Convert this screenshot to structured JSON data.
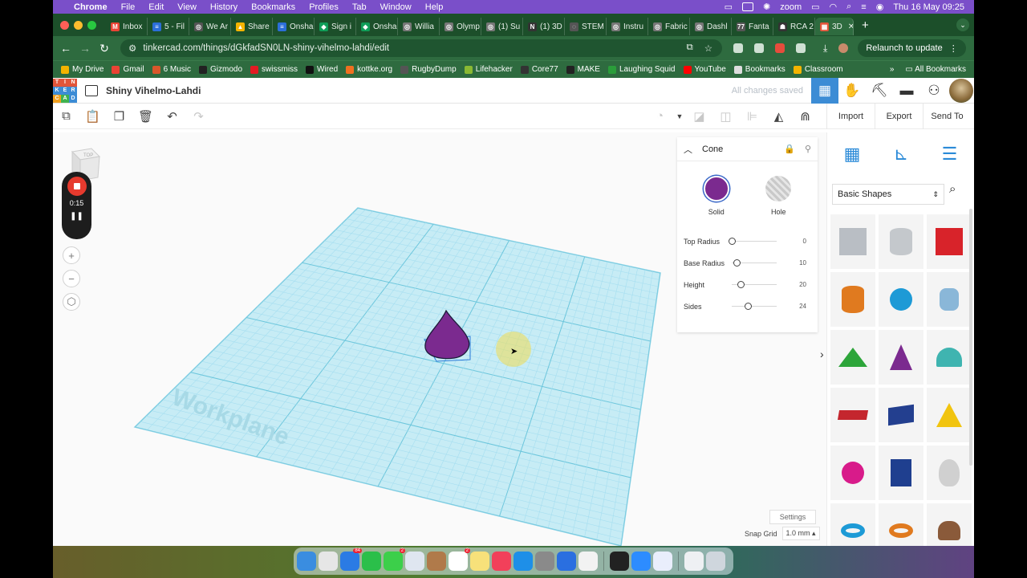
{
  "menubar": {
    "app": "Chrome",
    "items": [
      "File",
      "Edit",
      "View",
      "History",
      "Bookmarks",
      "Profiles",
      "Tab",
      "Window",
      "Help"
    ],
    "zoom": "zoom",
    "clock": "Thu 16 May  09:25"
  },
  "tabs": [
    {
      "label": "Inbox",
      "color": "#ea4335",
      "glyph": "M"
    },
    {
      "label": "5 - Fil",
      "color": "#2b6ed9",
      "glyph": "≡"
    },
    {
      "label": "We Ar",
      "color": "#555555",
      "glyph": "◎"
    },
    {
      "label": "Share",
      "color": "#f4b400",
      "glyph": "▲"
    },
    {
      "label": "Onsha",
      "color": "#2b6ed9",
      "glyph": "≡"
    },
    {
      "label": "Sign i",
      "color": "#0f9d58",
      "glyph": "◆"
    },
    {
      "label": "Onsha",
      "color": "#0f9d58",
      "glyph": "◆"
    },
    {
      "label": "Willia",
      "color": "#777777",
      "glyph": "◎"
    },
    {
      "label": "Olymp",
      "color": "#777777",
      "glyph": "◎"
    },
    {
      "label": "(1) Su",
      "color": "#777777",
      "glyph": "◎"
    },
    {
      "label": "(1) 3D",
      "color": "#333333",
      "glyph": "N"
    },
    {
      "label": "STEM",
      "color": "#555555",
      "glyph": "◌"
    },
    {
      "label": "Instru",
      "color": "#777777",
      "glyph": "◎"
    },
    {
      "label": "Fabric",
      "color": "#777777",
      "glyph": "◎"
    },
    {
      "label": "Dashl",
      "color": "#777777",
      "glyph": "◎"
    },
    {
      "label": "Fanta",
      "color": "#555555",
      "glyph": "77"
    },
    {
      "label": "RCA 2",
      "color": "#333333",
      "glyph": "☗"
    },
    {
      "label": "3D",
      "color": "#e2553a",
      "glyph": "▦",
      "active": true
    }
  ],
  "omnibox": {
    "url": "tinkercad.com/things/dGkfadSN0LN-shiny-vihelmo-lahdi/edit"
  },
  "relaunch_label": "Relaunch to update",
  "bookmarks": [
    {
      "label": "My Drive",
      "color": "#f4b400"
    },
    {
      "label": "Gmail",
      "color": "#ea4335"
    },
    {
      "label": "6 Music",
      "color": "#d9572b"
    },
    {
      "label": "Gizmodo",
      "color": "#222222"
    },
    {
      "label": "swissmiss",
      "color": "#e31b23"
    },
    {
      "label": "Wired",
      "color": "#111111"
    },
    {
      "label": "kottke.org",
      "color": "#f07020"
    },
    {
      "label": "RugbyDump",
      "color": "#555555"
    },
    {
      "label": "Lifehacker",
      "color": "#8ab933"
    },
    {
      "label": "Core77",
      "color": "#333333"
    },
    {
      "label": "MAKE",
      "color": "#222222"
    },
    {
      "label": "Laughing Squid",
      "color": "#2a9d3a"
    },
    {
      "label": "YouTube",
      "color": "#ff0000"
    },
    {
      "label": "Bookmarks",
      "color": "#dddddd"
    },
    {
      "label": "Classroom",
      "color": "#f4b400"
    }
  ],
  "all_bookmarks": "All Bookmarks",
  "tinkercad": {
    "logo_letters": [
      "T",
      "I",
      "N",
      "K",
      "E",
      "R",
      "C",
      "A",
      "D"
    ],
    "design_title": "Shiny Vihelmo-Lahdi",
    "saved_status": "All changes saved",
    "actions": {
      "import": "Import",
      "export": "Export",
      "send_to": "Send To"
    },
    "viewcube_label": "TOP",
    "recording_time": "0:15",
    "workplane_label": "Workplane",
    "settings_label": "Settings",
    "snap_grid_label": "Snap Grid",
    "snap_grid_value": "1.0 mm"
  },
  "inspector": {
    "shape_name": "Cone",
    "solid_label": "Solid",
    "hole_label": "Hole",
    "solid_color": "#7b2a8f",
    "params": [
      {
        "label": "Top Radius",
        "value": "0",
        "fraction": 0.0
      },
      {
        "label": "Base Radius",
        "value": "10",
        "fraction": 0.1
      },
      {
        "label": "Height",
        "value": "20",
        "fraction": 0.2
      },
      {
        "label": "Sides",
        "value": "24",
        "fraction": 0.35
      }
    ]
  },
  "shapes_panel": {
    "library": "Basic Shapes",
    "items": [
      {
        "name": "box-hole",
        "color": "#b9bec4"
      },
      {
        "name": "cylinder-hole",
        "color": "#c4c8cc"
      },
      {
        "name": "box",
        "color": "#d8232a"
      },
      {
        "name": "cylinder",
        "color": "#e07a1f"
      },
      {
        "name": "sphere",
        "color": "#1d9ad6"
      },
      {
        "name": "scribble",
        "color": "#8ab7d8"
      },
      {
        "name": "roof",
        "color": "#2da53a"
      },
      {
        "name": "cone",
        "color": "#7b2a8f"
      },
      {
        "name": "round-roof",
        "color": "#3fb4b0"
      },
      {
        "name": "text",
        "color": "#c4262e"
      },
      {
        "name": "wedge",
        "color": "#233f8f"
      },
      {
        "name": "pyramid",
        "color": "#f1c40f"
      },
      {
        "name": "half-sphere",
        "color": "#d81b8a"
      },
      {
        "name": "polygon",
        "color": "#1f3f8f"
      },
      {
        "name": "paraboloid",
        "color": "#d0d0d0"
      },
      {
        "name": "torus",
        "color": "#1d9ad6"
      },
      {
        "name": "tube",
        "color": "#e07a1f"
      },
      {
        "name": "heart",
        "color": "#8a5a3a"
      }
    ]
  }
}
